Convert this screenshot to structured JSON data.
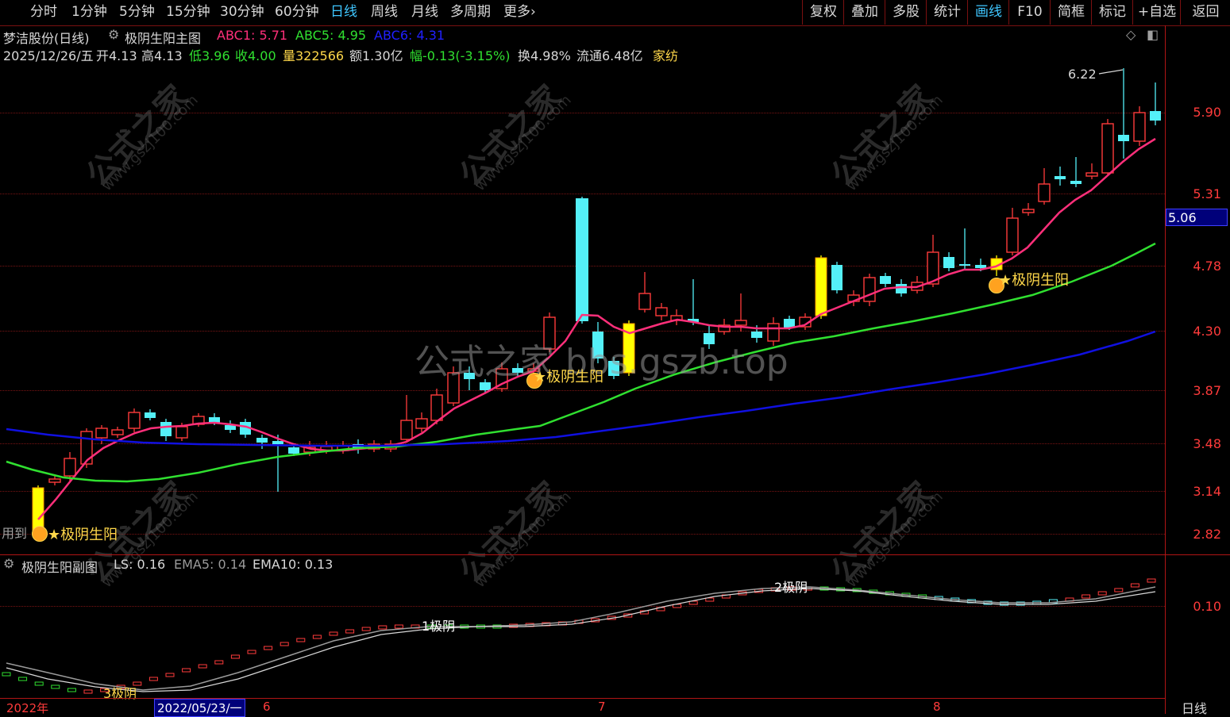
{
  "toolbar": {
    "left_items": [
      "分时",
      "1分钟",
      "5分钟",
      "15分钟",
      "30分钟",
      "60分钟",
      "日线",
      "周线",
      "月线",
      "多周期",
      "更多"
    ],
    "active_left": "日线",
    "right_items": [
      "复权",
      "叠加",
      "多股",
      "统计",
      "画线",
      "F10",
      "简框",
      "标记",
      "+自选",
      "返回"
    ],
    "active_right": "画线"
  },
  "header": {
    "stock": "梦洁股份(日线)",
    "indicator": "极阴生阳主图",
    "abc1_label": "ABC1: 5.71",
    "abc5_label": "ABC5: 4.95",
    "abc6_label": "ABC6: 4.31",
    "date": "2025/12/26/五",
    "open": "开4.13",
    "high": "高4.13",
    "low": "低3.96",
    "close": "收4.00",
    "volume": "量322566",
    "amount": "额1.30亿",
    "change": "幅-0.13(-3.15%)",
    "turnover": "换4.98%",
    "float_cap": "流通6.48亿",
    "industry": "家纺"
  },
  "price_axis": [
    "5.90",
    "5.31",
    "4.78",
    "4.30",
    "3.87",
    "3.48",
    "3.14",
    "2.82"
  ],
  "current_price": "5.06",
  "sub_axis": [
    "0.10"
  ],
  "sub_header": {
    "name": "极阴生阳副图",
    "ls": "LS: 0.16",
    "ema5": "EMA5: 0.14",
    "ema10": "EMA10: 0.13"
  },
  "signals": [
    "极阴生阳",
    "极阴生阳",
    "极阴生阳"
  ],
  "sub_signals": [
    "3极阴",
    "1极阴",
    "2极阴"
  ],
  "max_label": "6.22",
  "left_text": "用到",
  "date_axis": [
    "2022年",
    "2022/05/23/一",
    "6",
    "7",
    "8"
  ],
  "period_label": "日线",
  "watermark": {
    "big": "公式之家",
    "small": "www.gszj100.com",
    "center": "公式之家 bbs.gszb.top"
  },
  "colors": {
    "up": "#ff3b3b",
    "down": "#54f0f8",
    "ma_pink": "#ff2f7a",
    "ma_green": "#30e030",
    "ma_blue": "#1010e0",
    "yellow": "#ffff00"
  }
}
